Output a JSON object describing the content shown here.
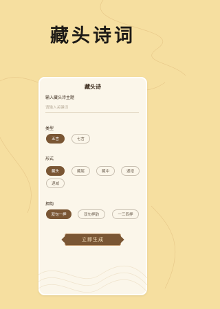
{
  "app_title": "藏头诗词",
  "card": {
    "title": "藏头诗",
    "theme_label": "输入藏头诗主题",
    "input_placeholder": "请输入关键词",
    "type_label": "类型",
    "type_options": [
      "五言",
      "七言"
    ],
    "form_label": "形式",
    "form_options": [
      "藏头",
      "藏尾",
      "藏中",
      "递增",
      "递减"
    ],
    "rhyme_label": "押韵",
    "rhyme_options": [
      "双句一押",
      "双句押韵",
      "一三四押"
    ],
    "generate_label": "立即生成"
  },
  "colors": {
    "background": "#f6dfa0",
    "accent": "#7a5634",
    "card": "#fbf6ea"
  }
}
